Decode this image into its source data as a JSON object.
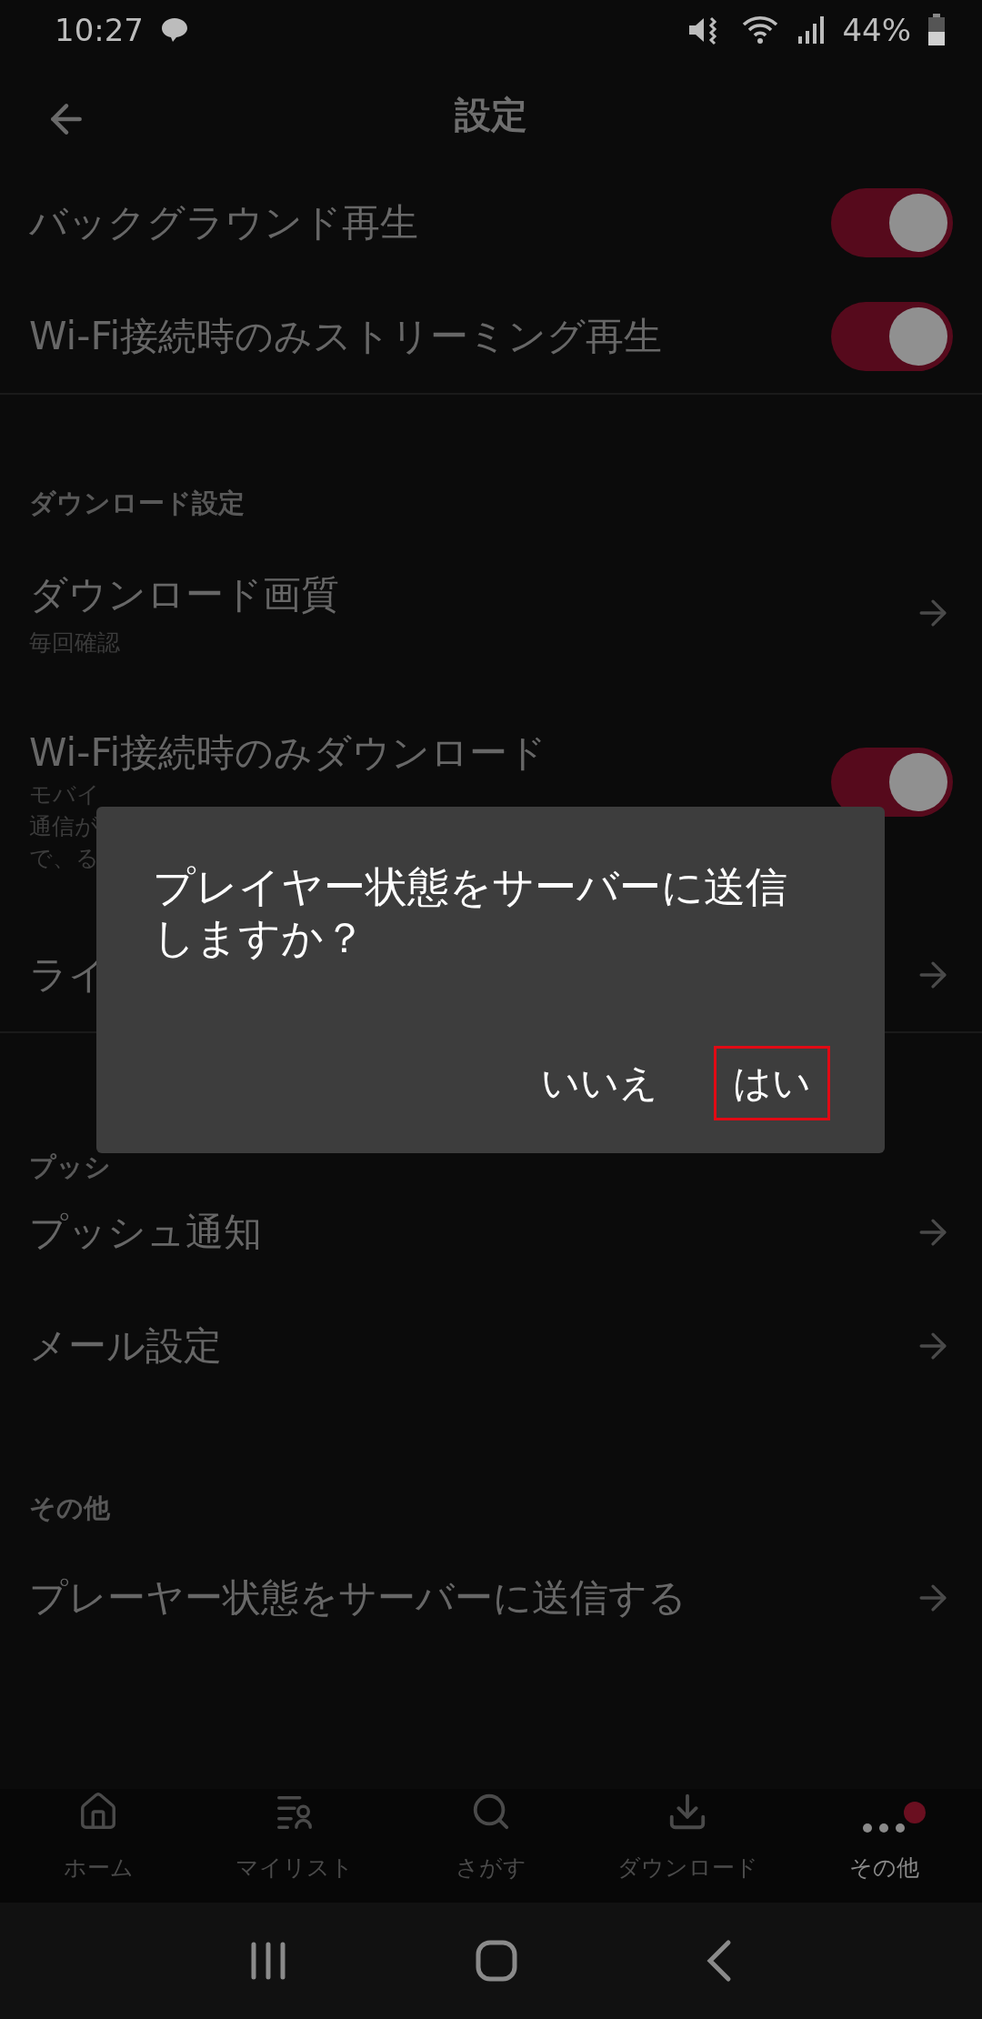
{
  "status_bar": {
    "time": "10:27",
    "battery": "44%"
  },
  "header": {
    "title": "設定"
  },
  "sections": [
    {
      "rows": [
        {
          "kind": "toggle",
          "label": "バックグラウンド再生",
          "on": true
        },
        {
          "kind": "toggle",
          "label": "Wi-Fi接続時のみストリーミング再生",
          "on": true
        }
      ]
    },
    {
      "title": "ダウンロード設定",
      "rows": [
        {
          "kind": "link",
          "label": "ダウンロード画質",
          "subtitle": "毎回確認"
        },
        {
          "kind": "toggle",
          "label": "Wi-Fi接続時のみダウンロード",
          "on": true,
          "description": [
            "モバイ",
            "通信が",
            "で、る"
          ]
        },
        {
          "kind": "link",
          "label": "ライ"
        }
      ]
    },
    {
      "title": "プッシ",
      "rows": [
        {
          "kind": "link",
          "label": "プッシュ通知"
        },
        {
          "kind": "link",
          "label": "メール設定"
        }
      ]
    },
    {
      "title": "その他",
      "rows": [
        {
          "kind": "link",
          "label": "プレーヤー状態をサーバーに送信する"
        }
      ]
    }
  ],
  "dialog": {
    "message": "プレイヤー状態をサーバーに送信しますか？",
    "buttons": [
      {
        "label": "いいえ",
        "highlighted": false
      },
      {
        "label": "はい",
        "highlighted": true
      }
    ]
  },
  "bottom_nav": [
    {
      "kind": "home",
      "label": "ホーム",
      "selected": false,
      "badge": false
    },
    {
      "kind": "mylist",
      "label": "マイリスト",
      "selected": false,
      "badge": false
    },
    {
      "kind": "search",
      "label": "さがす",
      "selected": false,
      "badge": false
    },
    {
      "kind": "download",
      "label": "ダウンロード",
      "selected": false,
      "badge": false
    },
    {
      "kind": "more",
      "label": "その他",
      "selected": true,
      "badge": true
    }
  ]
}
